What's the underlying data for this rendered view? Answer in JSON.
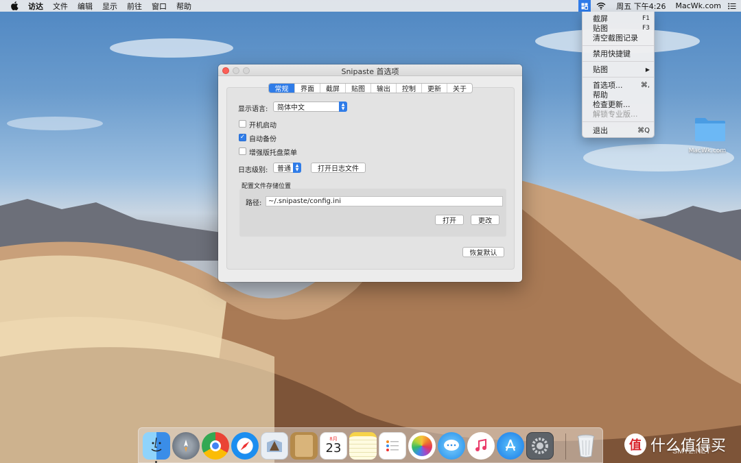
{
  "menubar": {
    "app_items": [
      "访达",
      "文件",
      "编辑",
      "显示",
      "前往",
      "窗口",
      "帮助"
    ],
    "datetime": "周五 下午4:26",
    "site": "MacWk.com"
  },
  "tray_menu": {
    "items": [
      {
        "label": "截屏",
        "shortcut": "F1"
      },
      {
        "label": "贴图",
        "shortcut": "F3"
      },
      {
        "label": "清空截图记录",
        "shortcut": ""
      },
      {
        "label": "禁用快捷键",
        "shortcut": ""
      },
      {
        "label": "贴图",
        "shortcut": "▶"
      },
      {
        "label": "首选项...",
        "shortcut": "⌘,"
      },
      {
        "label": "帮助",
        "shortcut": ""
      },
      {
        "label": "检查更新...",
        "shortcut": ""
      },
      {
        "label": "解锁专业版...",
        "shortcut": ""
      },
      {
        "label": "退出",
        "shortcut": "⌘Q"
      }
    ]
  },
  "desktop_folder": {
    "label": "MacWk.com",
    "color": "#5aaef0"
  },
  "window": {
    "title": "Snipaste 首选项",
    "tabs": [
      "常规",
      "界面",
      "截屏",
      "贴图",
      "输出",
      "控制",
      "更新",
      "关于"
    ],
    "active_tab": "常规",
    "language_label": "显示语言:",
    "language_value": "简体中文",
    "checkboxes": [
      {
        "label": "开机启动",
        "checked": false
      },
      {
        "label": "自动备份",
        "checked": true
      },
      {
        "label": "增强版托盘菜单",
        "checked": false
      }
    ],
    "log_label": "日志级别:",
    "log_value": "普通",
    "open_log_button": "打开日志文件",
    "config_section_label": "配置文件存储位置",
    "path_label": "路径:",
    "path_value": "~/.snipaste/config.ini",
    "open_button": "打开",
    "change_button": "更改",
    "restore_button": "恢复默认"
  },
  "dock": {
    "apps": [
      "finder",
      "launchpad",
      "chrome",
      "safari",
      "mail",
      "contacts",
      "calendar",
      "notes",
      "reminders",
      "photos",
      "messages",
      "music",
      "app-store",
      "system-preferences",
      "trash"
    ],
    "calendar_month": "8月",
    "calendar_day": "23"
  },
  "watermark": {
    "badge": "值",
    "text": "什么值得买",
    "sub": "SMYZ.NET"
  },
  "colors": {
    "accent": "#2f7ce8",
    "close": "#fc5f57"
  }
}
